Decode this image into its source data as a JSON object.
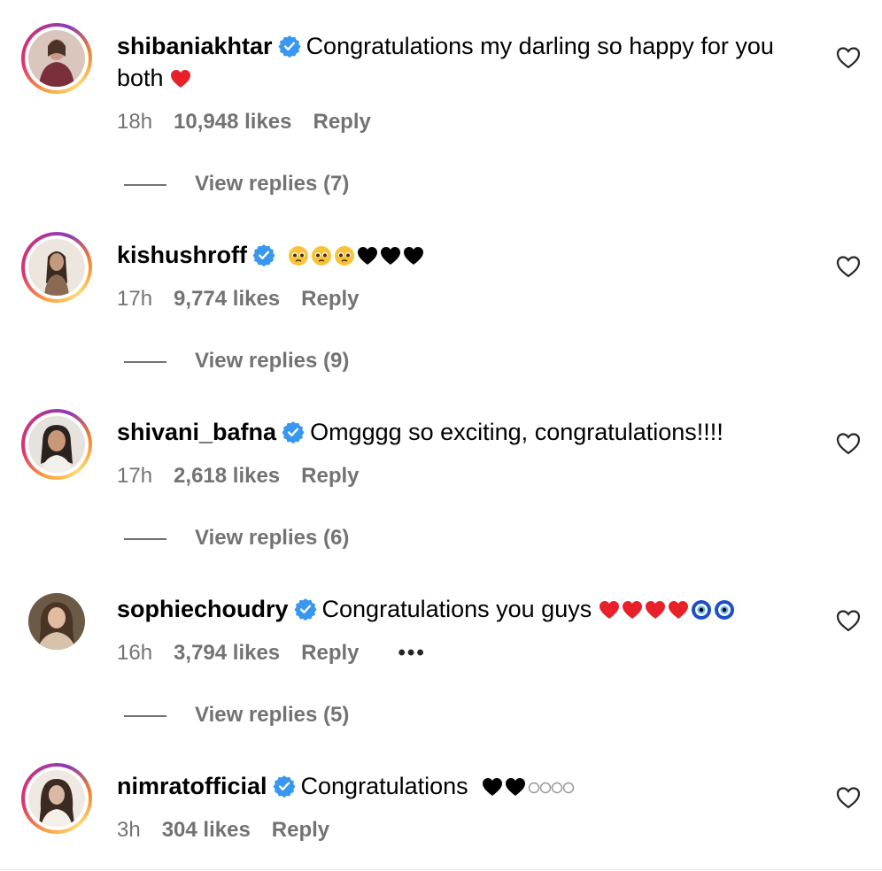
{
  "comments": [
    {
      "username": "shibaniakhtar",
      "text": "Congratulations my darling so happy for you both",
      "time": "18h",
      "likes": "10,948 likes",
      "reply_label": "Reply",
      "view_replies": "View replies (7)",
      "avatar_colors": [
        "#7a2f3a",
        "#c99a8a"
      ]
    },
    {
      "username": "kishushroff",
      "text": "",
      "time": "17h",
      "likes": "9,774 likes",
      "reply_label": "Reply",
      "view_replies": "View replies (9)",
      "avatar_colors": [
        "#e9e1d9",
        "#8a6a52"
      ]
    },
    {
      "username": "shivani_bafna",
      "text": "Omgggg so exciting, congratulations!!!!",
      "time": "17h",
      "likes": "2,618 likes",
      "reply_label": "Reply",
      "view_replies": "View replies (6)",
      "avatar_colors": [
        "#e6e3de",
        "#2b221d"
      ]
    },
    {
      "username": "sophiechoudry",
      "text": "Congratulations you guys",
      "time": "16h",
      "likes": "3,794 likes",
      "reply_label": "Reply",
      "more_label": "•••",
      "view_replies": "View replies (5)",
      "avatar_colors": [
        "#6b5a45",
        "#d8c2aa"
      ]
    },
    {
      "username": "nimratofficial",
      "text": "Congratulations",
      "time": "3h",
      "likes": "304 likes",
      "reply_label": "Reply",
      "avatar_colors": [
        "#3a2a22",
        "#d9b9a5"
      ]
    }
  ],
  "colors": {
    "verified": "#3897f0",
    "meta_text": "#737373",
    "heart_red": "#e8202a",
    "nazar_blue": "#1f4fc7"
  },
  "icons": {
    "like": "heart-outline-icon",
    "verified": "verified-badge-icon"
  }
}
